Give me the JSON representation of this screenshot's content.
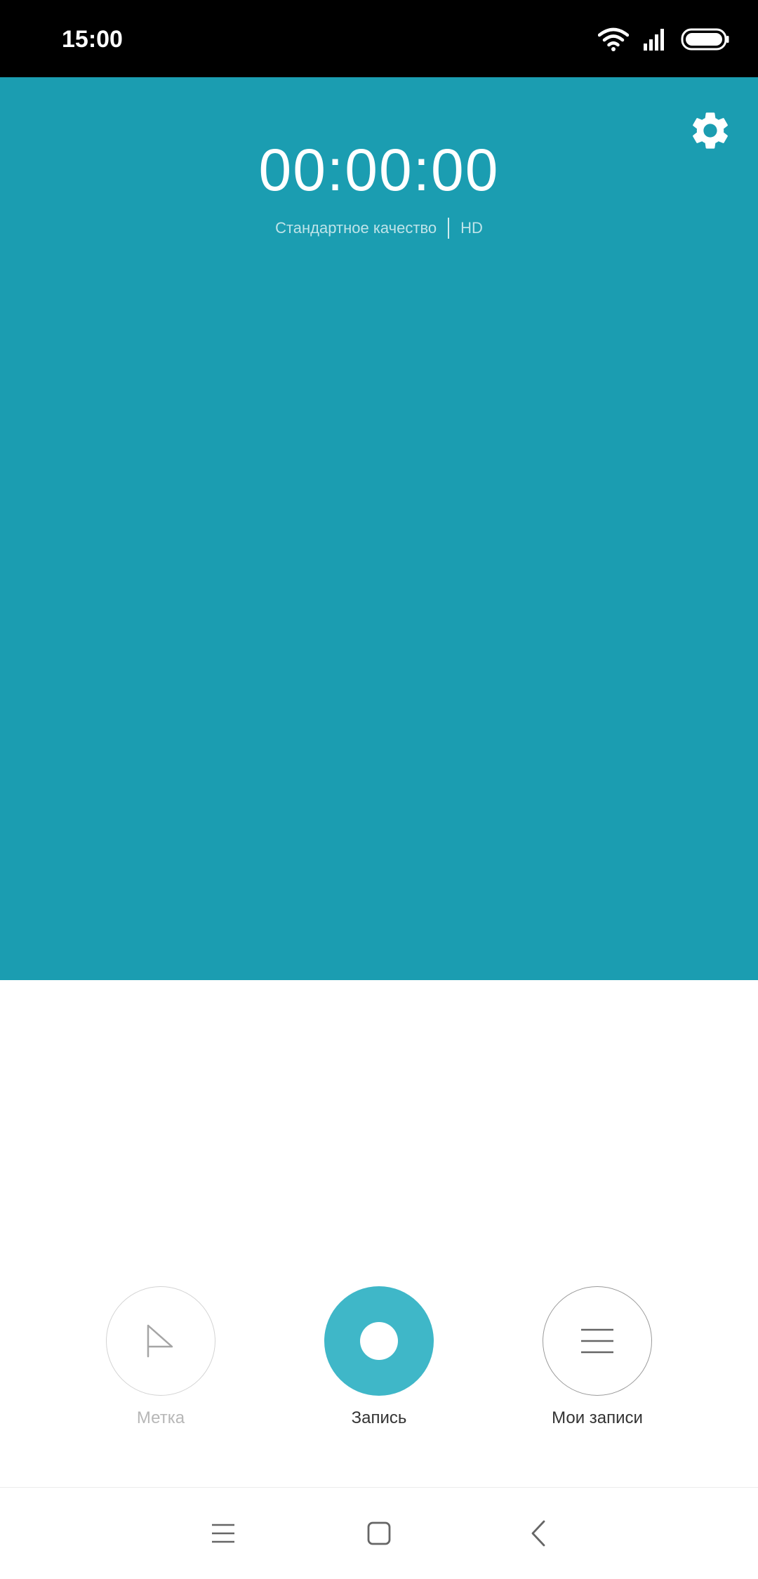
{
  "status_bar": {
    "time": "15:00",
    "icons": [
      "wifi-icon",
      "signal-icon",
      "battery-icon"
    ]
  },
  "header": {
    "background_color": "#1b9db1",
    "timer": "00:00:00",
    "quality": {
      "standard": "Стандартное качество",
      "hd": "HD"
    },
    "settings_icon": "gear-icon"
  },
  "controls": {
    "mark": {
      "label": "Метка",
      "icon": "flag-icon"
    },
    "record": {
      "label": "Запись",
      "icon": "record-icon",
      "color": "#3fb7c8"
    },
    "list": {
      "label": "Мои записи",
      "icon": "list-icon"
    }
  },
  "nav_bar": {
    "icons": [
      "menu-icon",
      "home-icon",
      "back-icon"
    ]
  }
}
